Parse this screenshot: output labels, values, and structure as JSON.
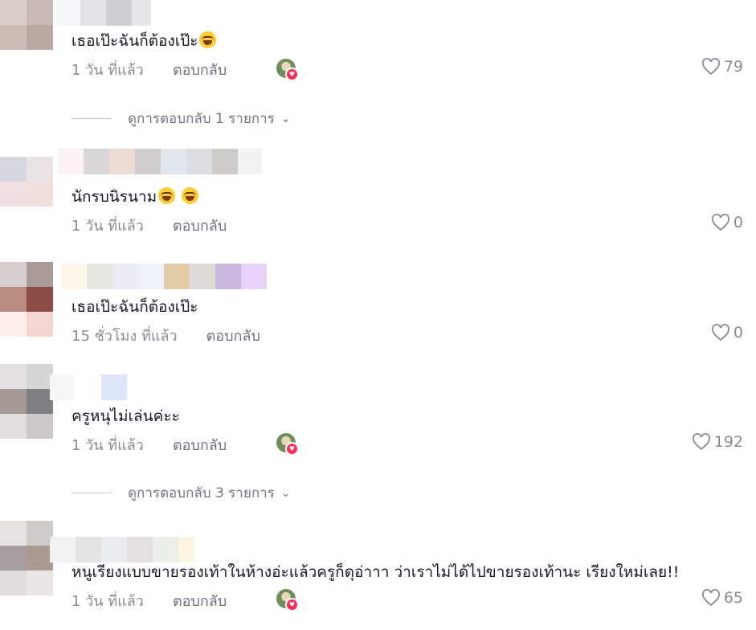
{
  "comments": [
    {
      "text": "เธอเป๊ะฉันก็ต้องเป๊ะ",
      "emoji_count": 1,
      "time": "1 วัน ที่แล้ว",
      "reply": "ตอบกลับ",
      "likes": "79",
      "creator_liked": true
    },
    {
      "text": "นักรบนิรนาม",
      "emoji_count": 2,
      "time": "1 วัน ที่แล้ว",
      "reply": "ตอบกลับ",
      "likes": "0",
      "creator_liked": false
    },
    {
      "text": "เธอเป๊ะฉันก็ต้องเป๊ะ",
      "emoji_count": 0,
      "time": "15 ชั่วโมง ที่แล้ว",
      "reply": "ตอบกลับ",
      "likes": "0",
      "creator_liked": false
    },
    {
      "text": "ครูหนุไม่เล่นค่ะะ",
      "emoji_count": 0,
      "time": "1 วัน ที่แล้ว",
      "reply": "ตอบกลับ",
      "likes": "192",
      "creator_liked": true
    },
    {
      "text": "หนูเรียงแบบขายรองเท้าในห้างอ่ะแล้วครูก็ดุอ่าาา ว่าเราไม่ได้ไปขายรองเท้านะ เรียงใหม่เลย!!",
      "emoji_count": 0,
      "time": "1 วัน ที่แล้ว",
      "reply": "ตอบกลับ",
      "likes": "65",
      "creator_liked": true
    }
  ],
  "view_replies": [
    {
      "label": "ดูการตอบกลับ 1 รายการ"
    },
    {
      "label": "ดูการตอบกลับ 3 รายการ"
    }
  ],
  "icons": {
    "like": "heart-outline-icon",
    "expand": "chevron-down-icon",
    "emoji": "laughing-emoji-icon"
  },
  "colors": {
    "text": "#161823",
    "meta": "#8a8b91",
    "creator_badge": "#fe2c55"
  }
}
